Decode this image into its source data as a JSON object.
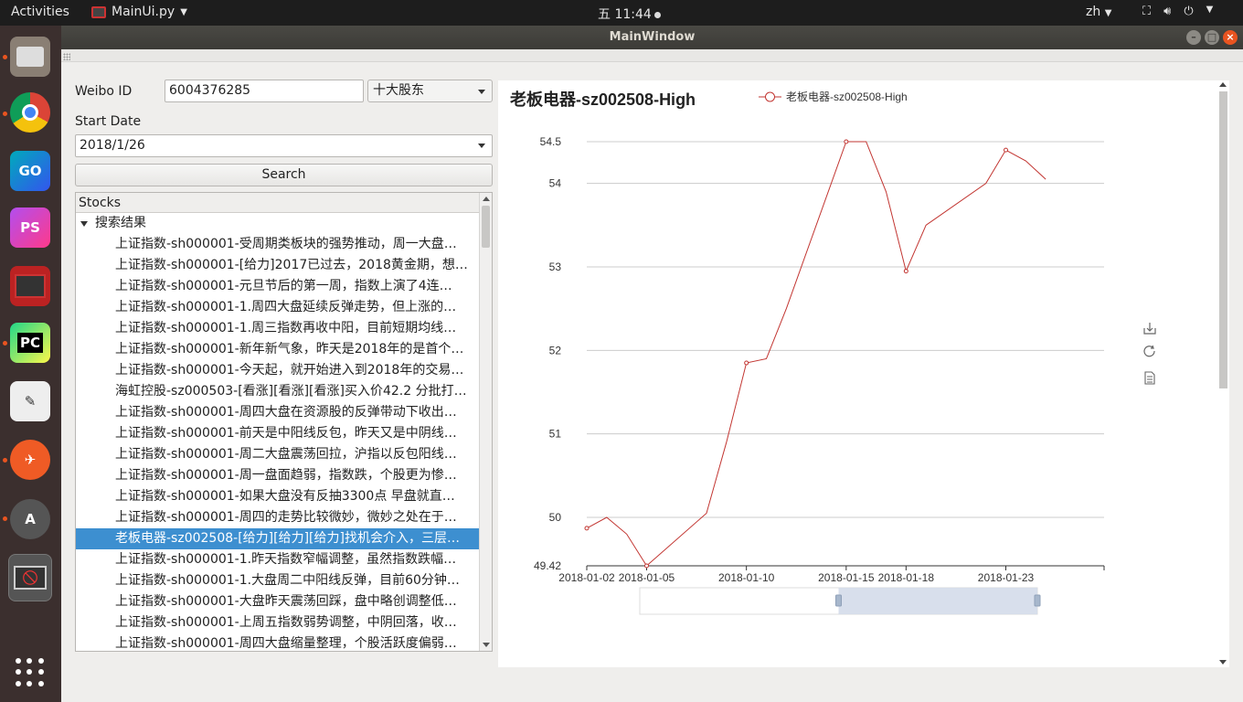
{
  "topbar": {
    "activities": "Activities",
    "app_name": "MainUi.py",
    "clock": "五 11:44",
    "lang": "zh"
  },
  "dock": {
    "items": [
      "files-icon",
      "chrome-icon",
      "goland-icon",
      "phpstorm-icon",
      "terminal-icon",
      "pycharm-icon",
      "text-editor-icon",
      "postman-icon",
      "software-updater-icon",
      "blocked-app-icon"
    ]
  },
  "window": {
    "title": "MainWindow"
  },
  "form": {
    "weibo_label": "Weibo ID",
    "weibo_value": "6004376285",
    "type_select": "十大股东",
    "start_label": "Start Date",
    "start_value": "2018/1/26",
    "search_label": "Search"
  },
  "tree": {
    "header": "Stocks",
    "root": "搜索结果",
    "selected_index": 14,
    "items": [
      "上证指数-sh000001-受周期类板块的强势推动，周一大盘…",
      "上证指数-sh000001-[给力]2017已过去，2018黄金期，想…",
      "上证指数-sh000001-元旦节后的第一周，指数上演了4连…",
      "上证指数-sh000001-1.周四大盘延续反弹走势，但上涨的…",
      "上证指数-sh000001-1.周三指数再收中阳，目前短期均线…",
      "上证指数-sh000001-新年新气象，昨天是2018年的是首个…",
      "上证指数-sh000001-今天起，就开始进入到2018年的交易…",
      "海虹控股-sz000503-[看涨][看涨][看涨]买入价42.2 分批打…",
      "上证指数-sh000001-周四大盘在资源股的反弹带动下收出…",
      "上证指数-sh000001-前天是中阳线反包，昨天又是中阴线…",
      "上证指数-sh000001-周二大盘震荡回拉，沪指以反包阳线…",
      "上证指数-sh000001-周一盘面趋弱，指数跌，个股更为惨…",
      "上证指数-sh000001-如果大盘没有反抽3300点 早盘就直…",
      "上证指数-sh000001-周四的走势比较微妙，微妙之处在于…",
      "老板电器-sz002508-[给力][给力][给力]找机会介入，三层…",
      "上证指数-sh000001-1.昨天指数窄幅调整，虽然指数跌幅…",
      "上证指数-sh000001-1.大盘周二中阳线反弹，目前60分钟…",
      "上证指数-sh000001-大盘昨天震荡回踩，盘中略创调整低…",
      "上证指数-sh000001-上周五指数弱势调整，中阴回落，收…",
      "上证指数-sh000001-周四大盘缩量整理，个股活跃度偏弱…"
    ]
  },
  "chart_data": {
    "type": "line",
    "title": "老板电器-sz002508-High",
    "legend": "老板电器-sz002508-High",
    "color": "#c23531",
    "ylim": [
      49.42,
      54.5
    ],
    "yticks": [
      "54.5",
      "54",
      "53",
      "52",
      "51",
      "50",
      "49.42"
    ],
    "xticks": [
      "2018-01-02",
      "2018-01-05",
      "2018-01-10",
      "2018-01-15",
      "2018-01-18",
      "2018-01-23"
    ],
    "x": [
      "2018-01-02",
      "2018-01-03",
      "2018-01-04",
      "2018-01-05",
      "2018-01-08",
      "2018-01-09",
      "2018-01-10",
      "2018-01-11",
      "2018-01-12",
      "2018-01-15",
      "2018-01-16",
      "2018-01-17",
      "2018-01-18",
      "2018-01-19",
      "2018-01-22",
      "2018-01-23",
      "2018-01-24",
      "2018-01-25"
    ],
    "values": [
      49.87,
      50.0,
      49.8,
      49.42,
      50.05,
      50.9,
      51.85,
      51.9,
      52.5,
      54.5,
      54.5,
      53.9,
      52.95,
      53.5,
      54.0,
      54.4,
      54.27,
      54.05
    ],
    "symbol_indices": [
      0,
      3,
      6,
      9,
      12,
      15
    ],
    "toolbox": [
      "download-icon",
      "refresh-icon",
      "data-view-icon"
    ],
    "datazoom": {
      "start_fraction": 0.5,
      "end_fraction": 1.0
    }
  }
}
